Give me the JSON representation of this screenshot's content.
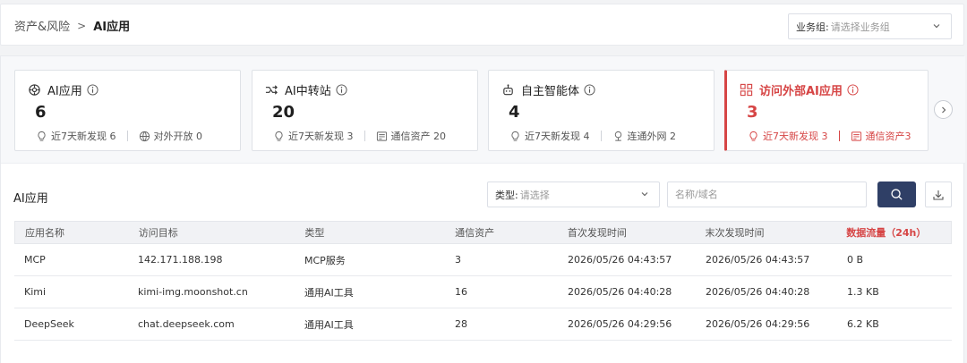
{
  "breadcrumb": {
    "parent": "资产&风险",
    "separator": ">",
    "current": "AI应用"
  },
  "business_group": {
    "label": "业务组:",
    "placeholder": "请选择业务组"
  },
  "cards": [
    {
      "title": "AI应用",
      "value": "6",
      "stats": [
        "近7天新发现 6",
        "对外开放 0"
      ]
    },
    {
      "title": "AI中转站",
      "value": "20",
      "stats": [
        "近7天新发现 3",
        "通信资产 20"
      ]
    },
    {
      "title": "自主智能体",
      "value": "4",
      "stats": [
        "近7天新发现 4",
        "连通外网 2"
      ]
    },
    {
      "title": "访问外部AI应用",
      "value": "3",
      "stats": [
        "近7天新发现 3",
        "通信资产3"
      ]
    }
  ],
  "colors": {
    "accent": "#d64545",
    "primary_button": "#2f3f66"
  },
  "section_title": "AI应用",
  "filter": {
    "type_label": "类型:",
    "type_placeholder": "请选择",
    "search_placeholder": "名称/域名"
  },
  "table": {
    "columns": [
      "应用名称",
      "访问目标",
      "类型",
      "通信资产",
      "首次发现时间",
      "末次发现时间",
      "数据流量（24h）"
    ],
    "rows": [
      [
        "MCP",
        "142.171.188.198",
        "MCP服务",
        "3",
        "2026/05/26 04:43:57",
        "2026/05/26 04:43:57",
        "0 B"
      ],
      [
        "Kimi",
        "kimi-img.moonshot.cn",
        "通用AI工具",
        "16",
        "2026/05/26 04:40:28",
        "2026/05/26 04:40:28",
        "1.3 KB"
      ],
      [
        "DeepSeek",
        "chat.deepseek.com",
        "通用AI工具",
        "28",
        "2026/05/26 04:29:56",
        "2026/05/26 04:29:56",
        "6.2 KB"
      ]
    ]
  }
}
